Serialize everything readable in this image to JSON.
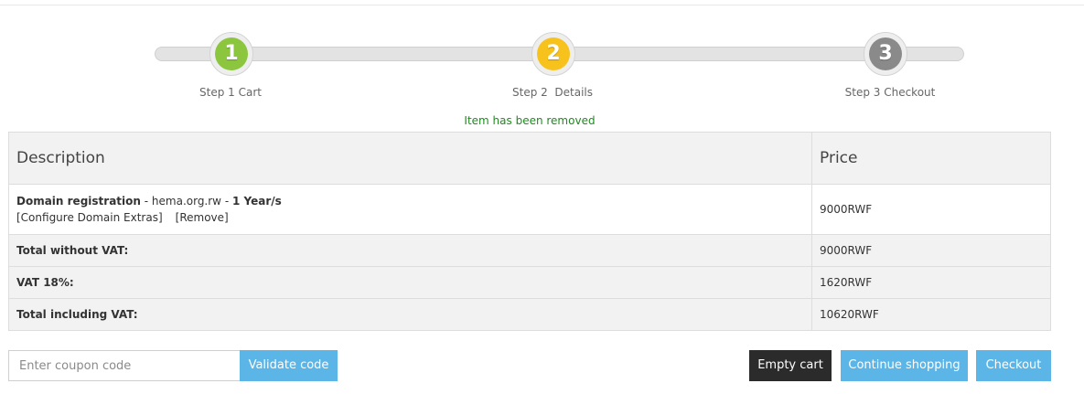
{
  "steps": [
    {
      "number": "1",
      "label": "Step 1 Cart",
      "color": "#8cc63e"
    },
    {
      "number": "2",
      "label": "Step 2  Details",
      "color": "#f7c21c"
    },
    {
      "number": "3",
      "label": "Step 3 Checkout",
      "color": "#8a8a8a"
    }
  ],
  "notice": "Item has been removed",
  "table": {
    "headers": {
      "description": "Description",
      "price": "Price"
    },
    "item": {
      "type": "Domain registration",
      "sep1": " - ",
      "domain": "hema.org.rw",
      "sep2": " - ",
      "period": "1 Year/s",
      "configure_link": "[Configure Domain Extras]",
      "remove_link": "[Remove]",
      "price": "9000RWF"
    },
    "totals": [
      {
        "label": "Total without VAT:",
        "value": "9000RWF"
      },
      {
        "label": "VAT 18%:",
        "value": "1620RWF"
      },
      {
        "label": "Total including VAT:",
        "value": "10620RWF"
      }
    ]
  },
  "coupon": {
    "placeholder": "Enter coupon code",
    "value": "",
    "button": "Validate code"
  },
  "actions": {
    "empty_cart": "Empty cart",
    "continue_shopping": "Continue shopping",
    "checkout": "Checkout"
  }
}
